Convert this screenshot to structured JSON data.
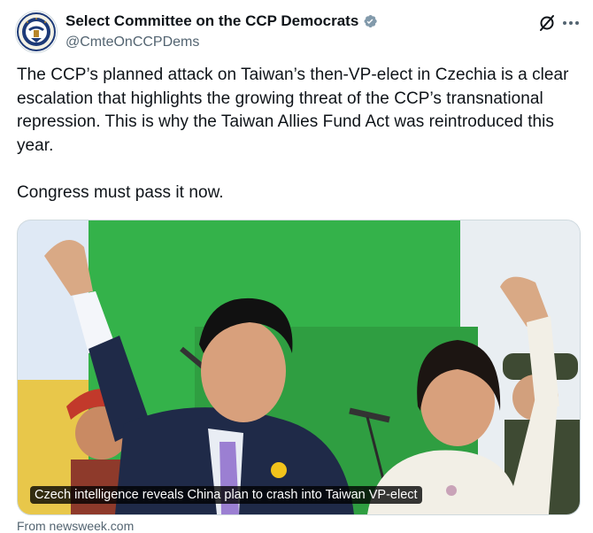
{
  "account": {
    "display_name": "Select Committee on the CCP Democrats",
    "handle": "@CmteOnCCPDems",
    "verified": true,
    "verified_badge_color": "#829aab"
  },
  "icons": {
    "avatar": "committee-seal",
    "verified": "verified-badge-icon",
    "grok": "grok-icon",
    "more": "more-icon"
  },
  "tweet": {
    "text": "The CCP’s planned attack on Taiwan’s then-VP-elect in Czechia is a clear escalation that highlights the growing threat of the CCP’s transnational repression. This is why the Taiwan Allies Fund Act was reintroduced this year.\n\nCongress must pass it now."
  },
  "card": {
    "caption": "Czech intelligence reveals China plan to crash into Taiwan VP-elect",
    "source": "From newsweek.com"
  }
}
